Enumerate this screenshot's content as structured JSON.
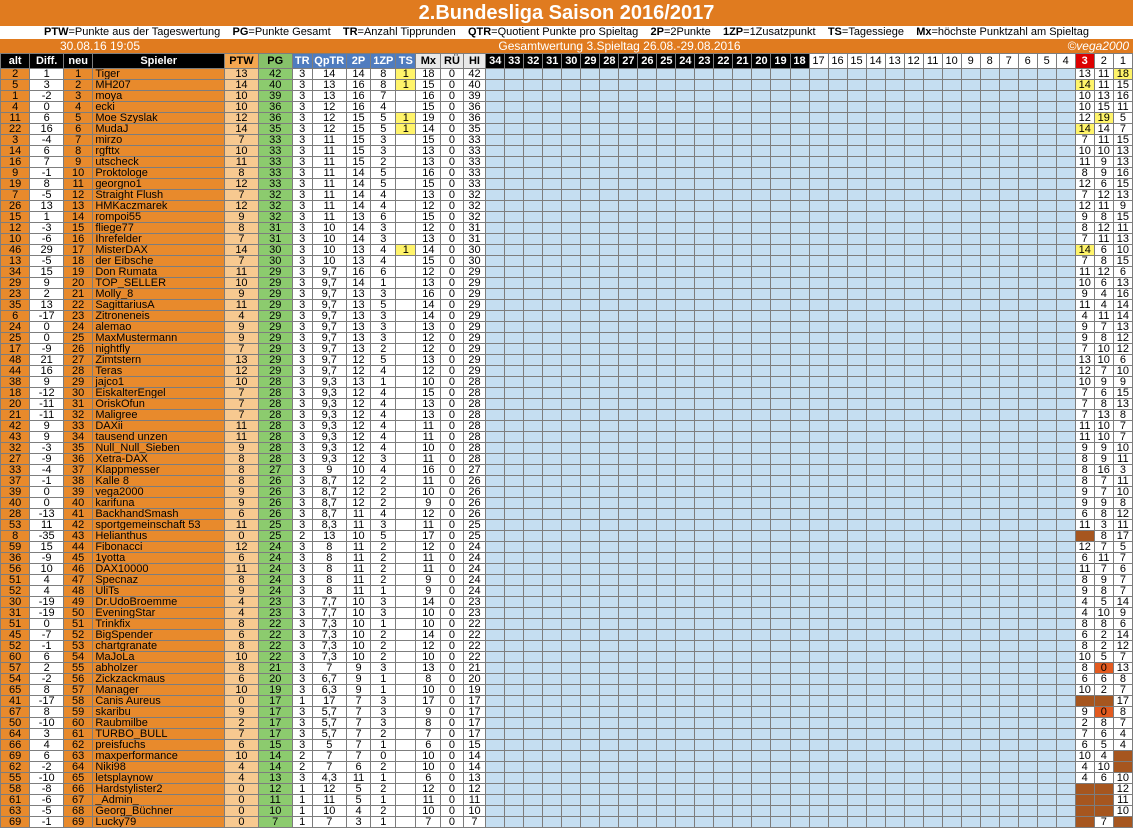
{
  "header": {
    "title": "2.Bundesliga Saison 2016/2017",
    "legend": [
      {
        "k": "PTW",
        "v": "=Punkte aus der Tageswertung"
      },
      {
        "k": "PG",
        "v": "=Punkte Gesamt"
      },
      {
        "k": "TR",
        "v": "=Anzahl Tipprunden"
      },
      {
        "k": "QTR",
        "v": "=Quotient Punkte pro Spieltag"
      },
      {
        "k": "2P",
        "v": "=2Punkte"
      },
      {
        "k": "1ZP",
        "v": "=1Zusatzpunkt"
      },
      {
        "k": "TS",
        "v": "=Tagessiege"
      },
      {
        "k": "Mx",
        "v": "=höchste Punktzahl am Spieltag"
      }
    ],
    "date": "30.08.16 19:05",
    "description": "Gesamtwertung 3.Spieltag 26.08.-29.08.2016",
    "copyright": "©vega2000"
  },
  "columns": [
    "alt",
    "Diff.",
    "neu",
    "Spieler",
    "PTW",
    "PG",
    "TR",
    "QpTR",
    "2P",
    "1ZP",
    "TS",
    "Mx",
    "RÜ",
    "HI"
  ],
  "week_columns": [
    "34",
    "33",
    "32",
    "31",
    "30",
    "29",
    "28",
    "27",
    "26",
    "25",
    "24",
    "23",
    "22",
    "21",
    "20",
    "19",
    "18",
    "17",
    "16",
    "15",
    "14",
    "13",
    "12",
    "11",
    "10",
    "9",
    "8",
    "7",
    "6",
    "5",
    "4",
    "3",
    "2",
    "1"
  ],
  "colors": {
    "orange": "#e88a2c",
    "green": "#8ccb6e",
    "blue": "#c5def1",
    "highlight": "#fff46a",
    "current": "#dd0000"
  },
  "rows": [
    [
      "2",
      "1",
      "1",
      "Tiger",
      "13",
      "42",
      "3",
      "14",
      "14",
      "8",
      "1",
      "18",
      "0",
      "42",
      "13",
      "11",
      "18"
    ],
    [
      "5",
      "3",
      "2",
      "MH207",
      "14",
      "40",
      "3",
      "13",
      "16",
      "8",
      "1",
      "15",
      "0",
      "40",
      "14",
      "11",
      "15"
    ],
    [
      "1",
      "-2",
      "3",
      "moya",
      "10",
      "39",
      "3",
      "13",
      "16",
      "7",
      "",
      "16",
      "0",
      "39",
      "10",
      "13",
      "16"
    ],
    [
      "4",
      "0",
      "4",
      "ecki",
      "10",
      "36",
      "3",
      "12",
      "16",
      "4",
      "",
      "15",
      "0",
      "36",
      "10",
      "15",
      "11"
    ],
    [
      "11",
      "6",
      "5",
      "Moe Szyslak",
      "12",
      "36",
      "3",
      "12",
      "15",
      "5",
      "1",
      "19",
      "0",
      "36",
      "12",
      "19",
      "5"
    ],
    [
      "22",
      "16",
      "6",
      "MudaJ",
      "14",
      "35",
      "3",
      "12",
      "15",
      "5",
      "1",
      "14",
      "0",
      "35",
      "14",
      "14",
      "7"
    ],
    [
      "3",
      "-4",
      "7",
      "mirzo",
      "7",
      "33",
      "3",
      "11",
      "15",
      "3",
      "",
      "15",
      "0",
      "33",
      "7",
      "11",
      "15"
    ],
    [
      "14",
      "6",
      "8",
      "rgfttx",
      "10",
      "33",
      "3",
      "11",
      "15",
      "3",
      "",
      "13",
      "0",
      "33",
      "10",
      "10",
      "13"
    ],
    [
      "16",
      "7",
      "9",
      "utscheck",
      "11",
      "33",
      "3",
      "11",
      "15",
      "2",
      "",
      "13",
      "0",
      "33",
      "11",
      "9",
      "13"
    ],
    [
      "9",
      "-1",
      "10",
      "Proktologe",
      "8",
      "33",
      "3",
      "11",
      "14",
      "5",
      "",
      "16",
      "0",
      "33",
      "8",
      "9",
      "16"
    ],
    [
      "19",
      "8",
      "11",
      "georgno1",
      "12",
      "33",
      "3",
      "11",
      "14",
      "5",
      "",
      "15",
      "0",
      "33",
      "12",
      "6",
      "15"
    ],
    [
      "7",
      "-5",
      "12",
      "Straight Flush",
      "7",
      "32",
      "3",
      "11",
      "14",
      "4",
      "",
      "13",
      "0",
      "32",
      "7",
      "12",
      "13"
    ],
    [
      "26",
      "13",
      "13",
      "HMKaczmarek",
      "12",
      "32",
      "3",
      "11",
      "14",
      "4",
      "",
      "12",
      "0",
      "32",
      "12",
      "11",
      "9"
    ],
    [
      "15",
      "1",
      "14",
      "rompoi55",
      "9",
      "32",
      "3",
      "11",
      "13",
      "6",
      "",
      "15",
      "0",
      "32",
      "9",
      "8",
      "15"
    ],
    [
      "12",
      "-3",
      "15",
      "fliege77",
      "8",
      "31",
      "3",
      "10",
      "14",
      "3",
      "",
      "12",
      "0",
      "31",
      "8",
      "12",
      "11"
    ],
    [
      "10",
      "-6",
      "16",
      "Ihrefelder",
      "7",
      "31",
      "3",
      "10",
      "14",
      "3",
      "",
      "13",
      "0",
      "31",
      "7",
      "11",
      "13"
    ],
    [
      "46",
      "29",
      "17",
      "MisterDAX",
      "14",
      "30",
      "3",
      "10",
      "13",
      "4",
      "1",
      "14",
      "0",
      "30",
      "14",
      "6",
      "10"
    ],
    [
      "13",
      "-5",
      "18",
      "der Eibsche",
      "7",
      "30",
      "3",
      "10",
      "13",
      "4",
      "",
      "15",
      "0",
      "30",
      "7",
      "8",
      "15"
    ],
    [
      "34",
      "15",
      "19",
      "Don Rumata",
      "11",
      "29",
      "3",
      "9,7",
      "16",
      "6",
      "",
      "12",
      "0",
      "29",
      "11",
      "12",
      "6"
    ],
    [
      "29",
      "9",
      "20",
      "TOP_SELLER",
      "10",
      "29",
      "3",
      "9,7",
      "14",
      "1",
      "",
      "13",
      "0",
      "29",
      "10",
      "6",
      "13"
    ],
    [
      "23",
      "2",
      "21",
      "Molly_8",
      "9",
      "29",
      "3",
      "9,7",
      "13",
      "3",
      "",
      "16",
      "0",
      "29",
      "9",
      "4",
      "16"
    ],
    [
      "35",
      "13",
      "22",
      "SagittariusA",
      "11",
      "29",
      "3",
      "9,7",
      "13",
      "5",
      "",
      "14",
      "0",
      "29",
      "11",
      "4",
      "14"
    ],
    [
      "6",
      "-17",
      "23",
      "Zitroneneis",
      "4",
      "29",
      "3",
      "9,7",
      "13",
      "3",
      "",
      "14",
      "0",
      "29",
      "4",
      "11",
      "14"
    ],
    [
      "24",
      "0",
      "24",
      "alemao",
      "9",
      "29",
      "3",
      "9,7",
      "13",
      "3",
      "",
      "13",
      "0",
      "29",
      "9",
      "7",
      "13"
    ],
    [
      "25",
      "0",
      "25",
      "MaxMustermann",
      "9",
      "29",
      "3",
      "9,7",
      "13",
      "3",
      "",
      "12",
      "0",
      "29",
      "9",
      "8",
      "12"
    ],
    [
      "17",
      "-9",
      "26",
      "nightfly",
      "7",
      "29",
      "3",
      "9,7",
      "13",
      "2",
      "",
      "12",
      "0",
      "29",
      "7",
      "10",
      "12"
    ],
    [
      "48",
      "21",
      "27",
      "Zimtstern",
      "13",
      "29",
      "3",
      "9,7",
      "12",
      "5",
      "",
      "13",
      "0",
      "29",
      "13",
      "10",
      "6"
    ],
    [
      "44",
      "16",
      "28",
      "Teras",
      "12",
      "29",
      "3",
      "9,7",
      "12",
      "4",
      "",
      "12",
      "0",
      "29",
      "12",
      "7",
      "10"
    ],
    [
      "38",
      "9",
      "29",
      "jajco1",
      "10",
      "28",
      "3",
      "9,3",
      "13",
      "1",
      "",
      "10",
      "0",
      "28",
      "10",
      "9",
      "9"
    ],
    [
      "18",
      "-12",
      "30",
      "EiskalterEngel",
      "7",
      "28",
      "3",
      "9,3",
      "12",
      "4",
      "",
      "15",
      "0",
      "28",
      "7",
      "6",
      "15"
    ],
    [
      "20",
      "-11",
      "31",
      "OriskOfun",
      "7",
      "28",
      "3",
      "9,3",
      "12",
      "4",
      "",
      "13",
      "0",
      "28",
      "7",
      "8",
      "13"
    ],
    [
      "21",
      "-11",
      "32",
      "Maligree",
      "7",
      "28",
      "3",
      "9,3",
      "12",
      "4",
      "",
      "13",
      "0",
      "28",
      "7",
      "13",
      "8"
    ],
    [
      "42",
      "9",
      "33",
      "DAXii",
      "11",
      "28",
      "3",
      "9,3",
      "12",
      "4",
      "",
      "11",
      "0",
      "28",
      "11",
      "10",
      "7"
    ],
    [
      "43",
      "9",
      "34",
      "tausend unzen",
      "11",
      "28",
      "3",
      "9,3",
      "12",
      "4",
      "",
      "11",
      "0",
      "28",
      "11",
      "10",
      "7"
    ],
    [
      "32",
      "-3",
      "35",
      "Null_Null_Sieben",
      "9",
      "28",
      "3",
      "9,3",
      "12",
      "4",
      "",
      "10",
      "0",
      "28",
      "9",
      "9",
      "10"
    ],
    [
      "27",
      "-9",
      "36",
      "Xetra-DAX",
      "8",
      "28",
      "3",
      "9,3",
      "12",
      "3",
      "",
      "11",
      "0",
      "28",
      "8",
      "9",
      "11"
    ],
    [
      "33",
      "-4",
      "37",
      "Klappmesser",
      "8",
      "27",
      "3",
      "9",
      "10",
      "4",
      "",
      "16",
      "0",
      "27",
      "8",
      "16",
      "3"
    ],
    [
      "37",
      "-1",
      "38",
      "Kalle 8",
      "8",
      "26",
      "3",
      "8,7",
      "12",
      "2",
      "",
      "11",
      "0",
      "26",
      "8",
      "7",
      "11"
    ],
    [
      "39",
      "0",
      "39",
      "vega2000",
      "9",
      "26",
      "3",
      "8,7",
      "12",
      "2",
      "",
      "10",
      "0",
      "26",
      "9",
      "7",
      "10"
    ],
    [
      "40",
      "0",
      "40",
      "karifuna",
      "9",
      "26",
      "3",
      "8,7",
      "12",
      "2",
      "",
      "9",
      "0",
      "26",
      "9",
      "9",
      "8"
    ],
    [
      "28",
      "-13",
      "41",
      "BackhandSmash",
      "6",
      "26",
      "3",
      "8,7",
      "11",
      "4",
      "",
      "12",
      "0",
      "26",
      "6",
      "8",
      "12"
    ],
    [
      "53",
      "11",
      "42",
      "sportgemeinschaft 53",
      "11",
      "25",
      "3",
      "8,3",
      "11",
      "3",
      "",
      "11",
      "0",
      "25",
      "11",
      "3",
      "11"
    ],
    [
      "8",
      "-35",
      "43",
      "Helianthus",
      "0",
      "25",
      "2",
      "13",
      "10",
      "5",
      "",
      "17",
      "0",
      "25",
      "",
      "8",
      "17"
    ],
    [
      "59",
      "15",
      "44",
      "Fibonacci",
      "12",
      "24",
      "3",
      "8",
      "11",
      "2",
      "",
      "12",
      "0",
      "24",
      "12",
      "7",
      "5"
    ],
    [
      "36",
      "-9",
      "45",
      "1yotta",
      "6",
      "24",
      "3",
      "8",
      "11",
      "2",
      "",
      "11",
      "0",
      "24",
      "6",
      "11",
      "7"
    ],
    [
      "56",
      "10",
      "46",
      "DAX10000",
      "11",
      "24",
      "3",
      "8",
      "11",
      "2",
      "",
      "11",
      "0",
      "24",
      "11",
      "7",
      "6"
    ],
    [
      "51",
      "4",
      "47",
      "Specnaz",
      "8",
      "24",
      "3",
      "8",
      "11",
      "2",
      "",
      "9",
      "0",
      "24",
      "8",
      "9",
      "7"
    ],
    [
      "52",
      "4",
      "48",
      "UliTs",
      "9",
      "24",
      "3",
      "8",
      "11",
      "1",
      "",
      "9",
      "0",
      "24",
      "9",
      "8",
      "7"
    ],
    [
      "30",
      "-19",
      "49",
      "Dr.UdoBroemme",
      "4",
      "23",
      "3",
      "7,7",
      "10",
      "3",
      "",
      "14",
      "0",
      "23",
      "4",
      "5",
      "14"
    ],
    [
      "31",
      "-19",
      "50",
      "EveningStar",
      "4",
      "23",
      "3",
      "7,7",
      "10",
      "3",
      "",
      "10",
      "0",
      "23",
      "4",
      "10",
      "9"
    ],
    [
      "51",
      "0",
      "51",
      "Trinkfix",
      "8",
      "22",
      "3",
      "7,3",
      "10",
      "1",
      "",
      "10",
      "0",
      "22",
      "8",
      "8",
      "6"
    ],
    [
      "45",
      "-7",
      "52",
      "BigSpender",
      "6",
      "22",
      "3",
      "7,3",
      "10",
      "2",
      "",
      "14",
      "0",
      "22",
      "6",
      "2",
      "14"
    ],
    [
      "52",
      "-1",
      "53",
      "chartgranate",
      "8",
      "22",
      "3",
      "7,3",
      "10",
      "2",
      "",
      "12",
      "0",
      "22",
      "8",
      "2",
      "12"
    ],
    [
      "60",
      "6",
      "54",
      "MaJoLa",
      "10",
      "22",
      "3",
      "7,3",
      "10",
      "2",
      "",
      "10",
      "0",
      "22",
      "10",
      "5",
      "7"
    ],
    [
      "57",
      "2",
      "55",
      "abholzer",
      "8",
      "21",
      "3",
      "7",
      "9",
      "3",
      "",
      "13",
      "0",
      "21",
      "8",
      "0",
      "13"
    ],
    [
      "54",
      "-2",
      "56",
      "Zickzackmaus",
      "6",
      "20",
      "3",
      "6,7",
      "9",
      "1",
      "",
      "8",
      "0",
      "20",
      "6",
      "6",
      "8"
    ],
    [
      "65",
      "8",
      "57",
      "Manager",
      "10",
      "19",
      "3",
      "6,3",
      "9",
      "1",
      "",
      "10",
      "0",
      "19",
      "10",
      "2",
      "7"
    ],
    [
      "41",
      "-17",
      "58",
      "Canis Aureus",
      "0",
      "17",
      "1",
      "17",
      "7",
      "3",
      "",
      "17",
      "0",
      "17",
      "",
      "",
      "17"
    ],
    [
      "67",
      "8",
      "59",
      "skaribu",
      "9",
      "17",
      "3",
      "5,7",
      "7",
      "3",
      "",
      "9",
      "0",
      "17",
      "9",
      "0",
      "8"
    ],
    [
      "50",
      "-10",
      "60",
      "Raubmilbe",
      "2",
      "17",
      "3",
      "5,7",
      "7",
      "3",
      "",
      "8",
      "0",
      "17",
      "2",
      "8",
      "7"
    ],
    [
      "64",
      "3",
      "61",
      "TURBO_BULL",
      "7",
      "17",
      "3",
      "5,7",
      "7",
      "2",
      "",
      "7",
      "0",
      "17",
      "7",
      "6",
      "4"
    ],
    [
      "66",
      "4",
      "62",
      "preisfuchs",
      "6",
      "15",
      "3",
      "5",
      "7",
      "1",
      "",
      "6",
      "0",
      "15",
      "6",
      "5",
      "4"
    ],
    [
      "69",
      "6",
      "63",
      "maxperformance",
      "10",
      "14",
      "2",
      "7",
      "7",
      "0",
      "",
      "10",
      "0",
      "14",
      "10",
      "4",
      ""
    ],
    [
      "62",
      "-2",
      "64",
      "Niki98",
      "4",
      "14",
      "2",
      "7",
      "6",
      "2",
      "",
      "10",
      "0",
      "14",
      "4",
      "10",
      ""
    ],
    [
      "55",
      "-10",
      "65",
      "letsplaynow",
      "4",
      "13",
      "3",
      "4,3",
      "11",
      "1",
      "",
      "6",
      "0",
      "13",
      "4",
      "6",
      "10"
    ],
    [
      "58",
      "-8",
      "66",
      "Hardstylister2",
      "0",
      "12",
      "1",
      "12",
      "5",
      "2",
      "",
      "12",
      "0",
      "12",
      "",
      "",
      "12"
    ],
    [
      "61",
      "-6",
      "67",
      "_Admin_",
      "0",
      "11",
      "1",
      "11",
      "5",
      "1",
      "",
      "11",
      "0",
      "11",
      "",
      "",
      "11"
    ],
    [
      "63",
      "-5",
      "68",
      "Georg_Büchner",
      "0",
      "10",
      "1",
      "10",
      "4",
      "2",
      "",
      "10",
      "0",
      "10",
      "",
      "",
      "10"
    ],
    [
      "69",
      "-1",
      "69",
      "Lucky79",
      "0",
      "7",
      "1",
      "7",
      "3",
      "1",
      "",
      "7",
      "0",
      "7",
      "",
      "7",
      ""
    ]
  ]
}
